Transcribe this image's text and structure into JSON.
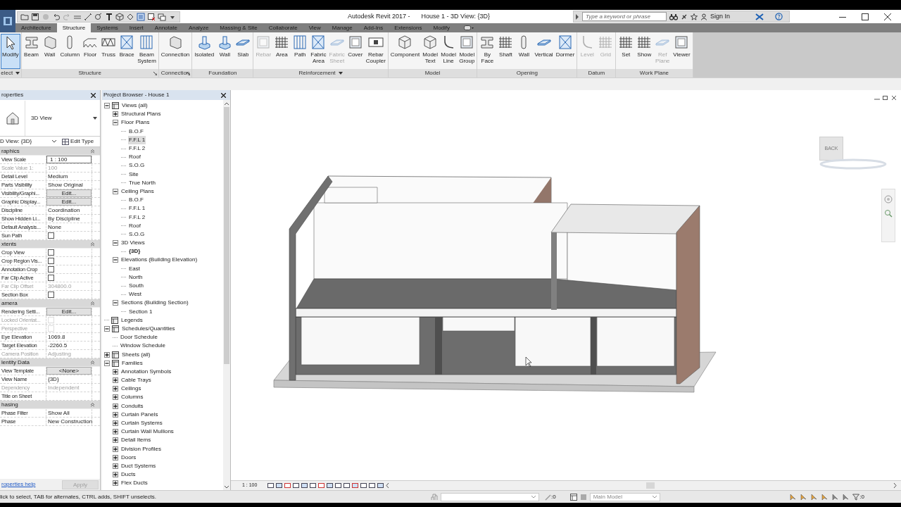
{
  "window": {
    "app_title": "Autodesk Revit 2017 -",
    "doc_title": "House 1 - 3D View: {3D}"
  },
  "search": {
    "placeholder": "Type a keyword or phrase"
  },
  "sign_in": "Sign In",
  "tabs": [
    {
      "label": "Architecture",
      "selected": false
    },
    {
      "label": "Structure",
      "selected": true
    },
    {
      "label": "Systems",
      "selected": false
    },
    {
      "label": "Insert",
      "selected": false
    },
    {
      "label": "Annotate",
      "selected": false
    },
    {
      "label": "Analyze",
      "selected": false
    },
    {
      "label": "Massing & Site",
      "selected": false
    },
    {
      "label": "Collaborate",
      "selected": false
    },
    {
      "label": "View",
      "selected": false
    },
    {
      "label": "Manage",
      "selected": false
    },
    {
      "label": "Add-Ins",
      "selected": false
    },
    {
      "label": "Extensions",
      "selected": false
    },
    {
      "label": "Modify",
      "selected": false
    }
  ],
  "ribbon": {
    "panels": [
      {
        "label": "elect",
        "menu": true,
        "launcher": false,
        "buttons": [
          {
            "label": "Modify",
            "selected": true,
            "disabled": false
          }
        ]
      },
      {
        "label": "Structure",
        "menu": false,
        "launcher": true,
        "buttons": [
          {
            "label": "Beam",
            "selected": false,
            "disabled": false
          },
          {
            "label": "Wall",
            "selected": false,
            "disabled": false
          },
          {
            "label": "Column",
            "selected": false,
            "disabled": false
          },
          {
            "label": "Floor",
            "selected": false,
            "disabled": false
          },
          {
            "label": "Truss",
            "selected": false,
            "disabled": false
          },
          {
            "label": "Brace",
            "selected": false,
            "disabled": false
          },
          {
            "label": "Beam\nSystem",
            "selected": false,
            "disabled": false
          }
        ]
      },
      {
        "label": "Connection",
        "menu": false,
        "launcher": true,
        "buttons": [
          {
            "label": "Connection",
            "selected": false,
            "disabled": false
          }
        ]
      },
      {
        "label": "Foundation",
        "menu": false,
        "launcher": false,
        "buttons": [
          {
            "label": "Isolated",
            "selected": false,
            "disabled": false
          },
          {
            "label": "Wall",
            "selected": false,
            "disabled": false
          },
          {
            "label": "Slab",
            "selected": false,
            "disabled": false
          }
        ]
      },
      {
        "label": "Reinforcement",
        "menu": true,
        "launcher": false,
        "buttons": [
          {
            "label": "Rebar",
            "selected": false,
            "disabled": true
          },
          {
            "label": "Area",
            "selected": false,
            "disabled": false
          },
          {
            "label": "Path",
            "selected": false,
            "disabled": false
          },
          {
            "label": "Fabric\nArea",
            "selected": false,
            "disabled": false
          },
          {
            "label": "Fabric\nSheet",
            "selected": false,
            "disabled": true
          },
          {
            "label": "Cover",
            "selected": false,
            "disabled": false
          },
          {
            "label": "Rebar\nCoupler",
            "selected": false,
            "disabled": false
          }
        ]
      },
      {
        "label": "Model",
        "menu": false,
        "launcher": false,
        "buttons": [
          {
            "label": "Component",
            "selected": false,
            "disabled": false
          },
          {
            "label": "Model\nText",
            "selected": false,
            "disabled": false
          },
          {
            "label": "Model\nLine",
            "selected": false,
            "disabled": false
          },
          {
            "label": "Model\nGroup",
            "selected": false,
            "disabled": false
          }
        ]
      },
      {
        "label": "Opening",
        "menu": false,
        "launcher": false,
        "buttons": [
          {
            "label": "By\nFace",
            "selected": false,
            "disabled": false
          },
          {
            "label": "Shaft",
            "selected": false,
            "disabled": false
          },
          {
            "label": "Wall",
            "selected": false,
            "disabled": false
          },
          {
            "label": "Vertical",
            "selected": false,
            "disabled": false
          },
          {
            "label": "Dormer",
            "selected": false,
            "disabled": false
          }
        ]
      },
      {
        "label": "Datum",
        "menu": false,
        "launcher": false,
        "buttons": [
          {
            "label": "Level",
            "selected": false,
            "disabled": true
          },
          {
            "label": "Grid",
            "selected": false,
            "disabled": true
          }
        ]
      },
      {
        "label": "Work Plane",
        "menu": false,
        "launcher": false,
        "buttons": [
          {
            "label": "Set",
            "selected": false,
            "disabled": false
          },
          {
            "label": "Show",
            "selected": false,
            "disabled": false
          },
          {
            "label": "Ref\nPlane",
            "selected": false,
            "disabled": true
          },
          {
            "label": "Viewer",
            "selected": false,
            "disabled": false
          }
        ]
      }
    ]
  },
  "properties": {
    "title": "roperties",
    "type_name": "3D View",
    "instance": "D View: {3D}",
    "edit_type": "Edit Type",
    "groups": [
      {
        "label": "raphics",
        "rows": [
          {
            "kind": "input",
            "label": "View Scale",
            "value": "1 : 100",
            "disabled": false
          },
          {
            "kind": "text",
            "label": "Scale Value    1:",
            "value": "100",
            "disabled": true
          },
          {
            "kind": "text",
            "label": "Detail Level",
            "value": "Medium",
            "disabled": false
          },
          {
            "kind": "text",
            "label": "Parts Visibility",
            "value": "Show Original",
            "disabled": false
          },
          {
            "kind": "button",
            "label": "Visibility/Graphi...",
            "value": "Edit...",
            "disabled": false
          },
          {
            "kind": "button",
            "label": "Graphic Display...",
            "value": "Edit...",
            "disabled": false
          },
          {
            "kind": "text",
            "label": "Discipline",
            "value": "Coordination",
            "disabled": false
          },
          {
            "kind": "text",
            "label": "Show Hidden Li...",
            "value": "By Discipline",
            "disabled": false
          },
          {
            "kind": "text",
            "label": "Default Analysis...",
            "value": "None",
            "disabled": false
          },
          {
            "kind": "checkbox",
            "label": "Sun Path",
            "checked": false,
            "disabled": false
          }
        ]
      },
      {
        "label": "xtents",
        "rows": [
          {
            "kind": "checkbox",
            "label": "Crop View",
            "checked": false,
            "disabled": false
          },
          {
            "kind": "checkbox",
            "label": "Crop Region Vis...",
            "checked": false,
            "disabled": false
          },
          {
            "kind": "checkbox",
            "label": "Annotation Crop",
            "checked": false,
            "disabled": false
          },
          {
            "kind": "checkbox",
            "label": "Far Clip Active",
            "checked": false,
            "disabled": false
          },
          {
            "kind": "text",
            "label": "Far Clip Offset",
            "value": "304800.0",
            "disabled": true
          },
          {
            "kind": "checkbox",
            "label": "Section Box",
            "checked": false,
            "disabled": false
          }
        ]
      },
      {
        "label": "amera",
        "rows": [
          {
            "kind": "button",
            "label": "Rendering Setti...",
            "value": "Edit...",
            "disabled": false
          },
          {
            "kind": "checkbox",
            "label": "Locked Orientat...",
            "checked": false,
            "disabled": true
          },
          {
            "kind": "checkbox",
            "label": "Perspective",
            "checked": false,
            "disabled": true
          },
          {
            "kind": "text",
            "label": "Eye Elevation",
            "value": "1069.8",
            "disabled": false
          },
          {
            "kind": "text",
            "label": "Target Elevation",
            "value": "-2260.5",
            "disabled": false
          },
          {
            "kind": "text",
            "label": "Camera Position",
            "value": "Adjusting",
            "disabled": true
          }
        ]
      },
      {
        "label": "lentity Data",
        "rows": [
          {
            "kind": "button",
            "label": "View Template",
            "value": "<None>",
            "disabled": false
          },
          {
            "kind": "text",
            "label": "View Name",
            "value": "{3D}",
            "disabled": false
          },
          {
            "kind": "text",
            "label": "Dependency",
            "value": "Independent",
            "disabled": true
          },
          {
            "kind": "text",
            "label": "Title on Sheet",
            "disabled": false
          }
        ]
      },
      {
        "label": "hasing",
        "rows": [
          {
            "kind": "text",
            "label": "Phase Filter",
            "value": "Show All",
            "disabled": false
          },
          {
            "kind": "text",
            "label": "Phase",
            "value": "New Construction",
            "disabled": false
          }
        ]
      }
    ],
    "help_link": "roperties help",
    "apply": {
      "label": "Apply",
      "disabled": true
    }
  },
  "project_browser": {
    "title": "Project Browser - House 1",
    "tree": [
      {
        "label": "Views (all)",
        "selected": false,
        "expanded": true,
        "children": [
          {
            "label": "Structural Plans",
            "selected": false,
            "expanded": false
          },
          {
            "label": "Floor Plans",
            "selected": false,
            "expanded": true,
            "children": [
              {
                "label": "B.O.F",
                "selected": false
              },
              {
                "label": "F.F.L 1",
                "selected": true
              },
              {
                "label": "F.F.L 2",
                "selected": false
              },
              {
                "label": "Roof",
                "selected": false
              },
              {
                "label": "S.O.G",
                "selected": false
              },
              {
                "label": "Site",
                "selected": false
              },
              {
                "label": "True North",
                "selected": false
              }
            ]
          },
          {
            "label": "Ceiling Plans",
            "selected": false,
            "expanded": true,
            "children": [
              {
                "label": "B.O.F",
                "selected": false
              },
              {
                "label": "F.F.L 1",
                "selected": false
              },
              {
                "label": "F.F.L 2",
                "selected": false
              },
              {
                "label": "Roof",
                "selected": false
              },
              {
                "label": "S.O.G",
                "selected": false
              }
            ]
          },
          {
            "label": "3D Views",
            "selected": false,
            "expanded": true,
            "children": [
              {
                "label": "{3D}",
                "selected": false,
                "current": true
              }
            ]
          },
          {
            "label": "Elevations (Building Elevation)",
            "selected": false,
            "expanded": true,
            "children": [
              {
                "label": "East",
                "selected": false
              },
              {
                "label": "North",
                "selected": false
              },
              {
                "label": "South",
                "selected": false
              },
              {
                "label": "West",
                "selected": false
              }
            ]
          },
          {
            "label": "Sections (Building Section)",
            "selected": false,
            "expanded": true,
            "children": [
              {
                "label": "Section 1",
                "selected": false
              }
            ]
          }
        ]
      },
      {
        "label": "Legends",
        "selected": false
      },
      {
        "label": "Schedules/Quantities",
        "selected": false,
        "expanded": true,
        "children": [
          {
            "label": "Door Schedule",
            "selected": false
          },
          {
            "label": "Window Schedule",
            "selected": false
          }
        ]
      },
      {
        "label": "Sheets (all)",
        "selected": false,
        "expanded": false
      },
      {
        "label": "Families",
        "selected": false,
        "expanded": true,
        "children": [
          {
            "label": "Annotation Symbols",
            "selected": false,
            "expanded": false
          },
          {
            "label": "Cable Trays",
            "selected": false,
            "expanded": false
          },
          {
            "label": "Ceilings",
            "selected": false,
            "expanded": false
          },
          {
            "label": "Columns",
            "selected": false,
            "expanded": false
          },
          {
            "label": "Conduits",
            "selected": false,
            "expanded": false
          },
          {
            "label": "Curtain Panels",
            "selected": false,
            "expanded": false
          },
          {
            "label": "Curtain Systems",
            "selected": false,
            "expanded": false
          },
          {
            "label": "Curtain Wall Mullions",
            "selected": false,
            "expanded": false
          },
          {
            "label": "Detail Items",
            "selected": false,
            "expanded": false
          },
          {
            "label": "Division Profiles",
            "selected": false,
            "expanded": false
          },
          {
            "label": "Doors",
            "selected": false,
            "expanded": false
          },
          {
            "label": "Duct Systems",
            "selected": false,
            "expanded": false
          },
          {
            "label": "Ducts",
            "selected": false,
            "expanded": false
          },
          {
            "label": "Flex Ducts",
            "selected": false,
            "expanded": false
          }
        ]
      }
    ]
  },
  "viewport": {
    "view_cube_label": "BACK"
  },
  "view_control_bar": {
    "scale": "1 : 100"
  },
  "status_bar": {
    "message": "lick to select, TAB for alternates, CTRL adds, SHIFT unselects.",
    "selection_count": ":0",
    "model": "Main Model",
    "filter_count": ":0"
  }
}
